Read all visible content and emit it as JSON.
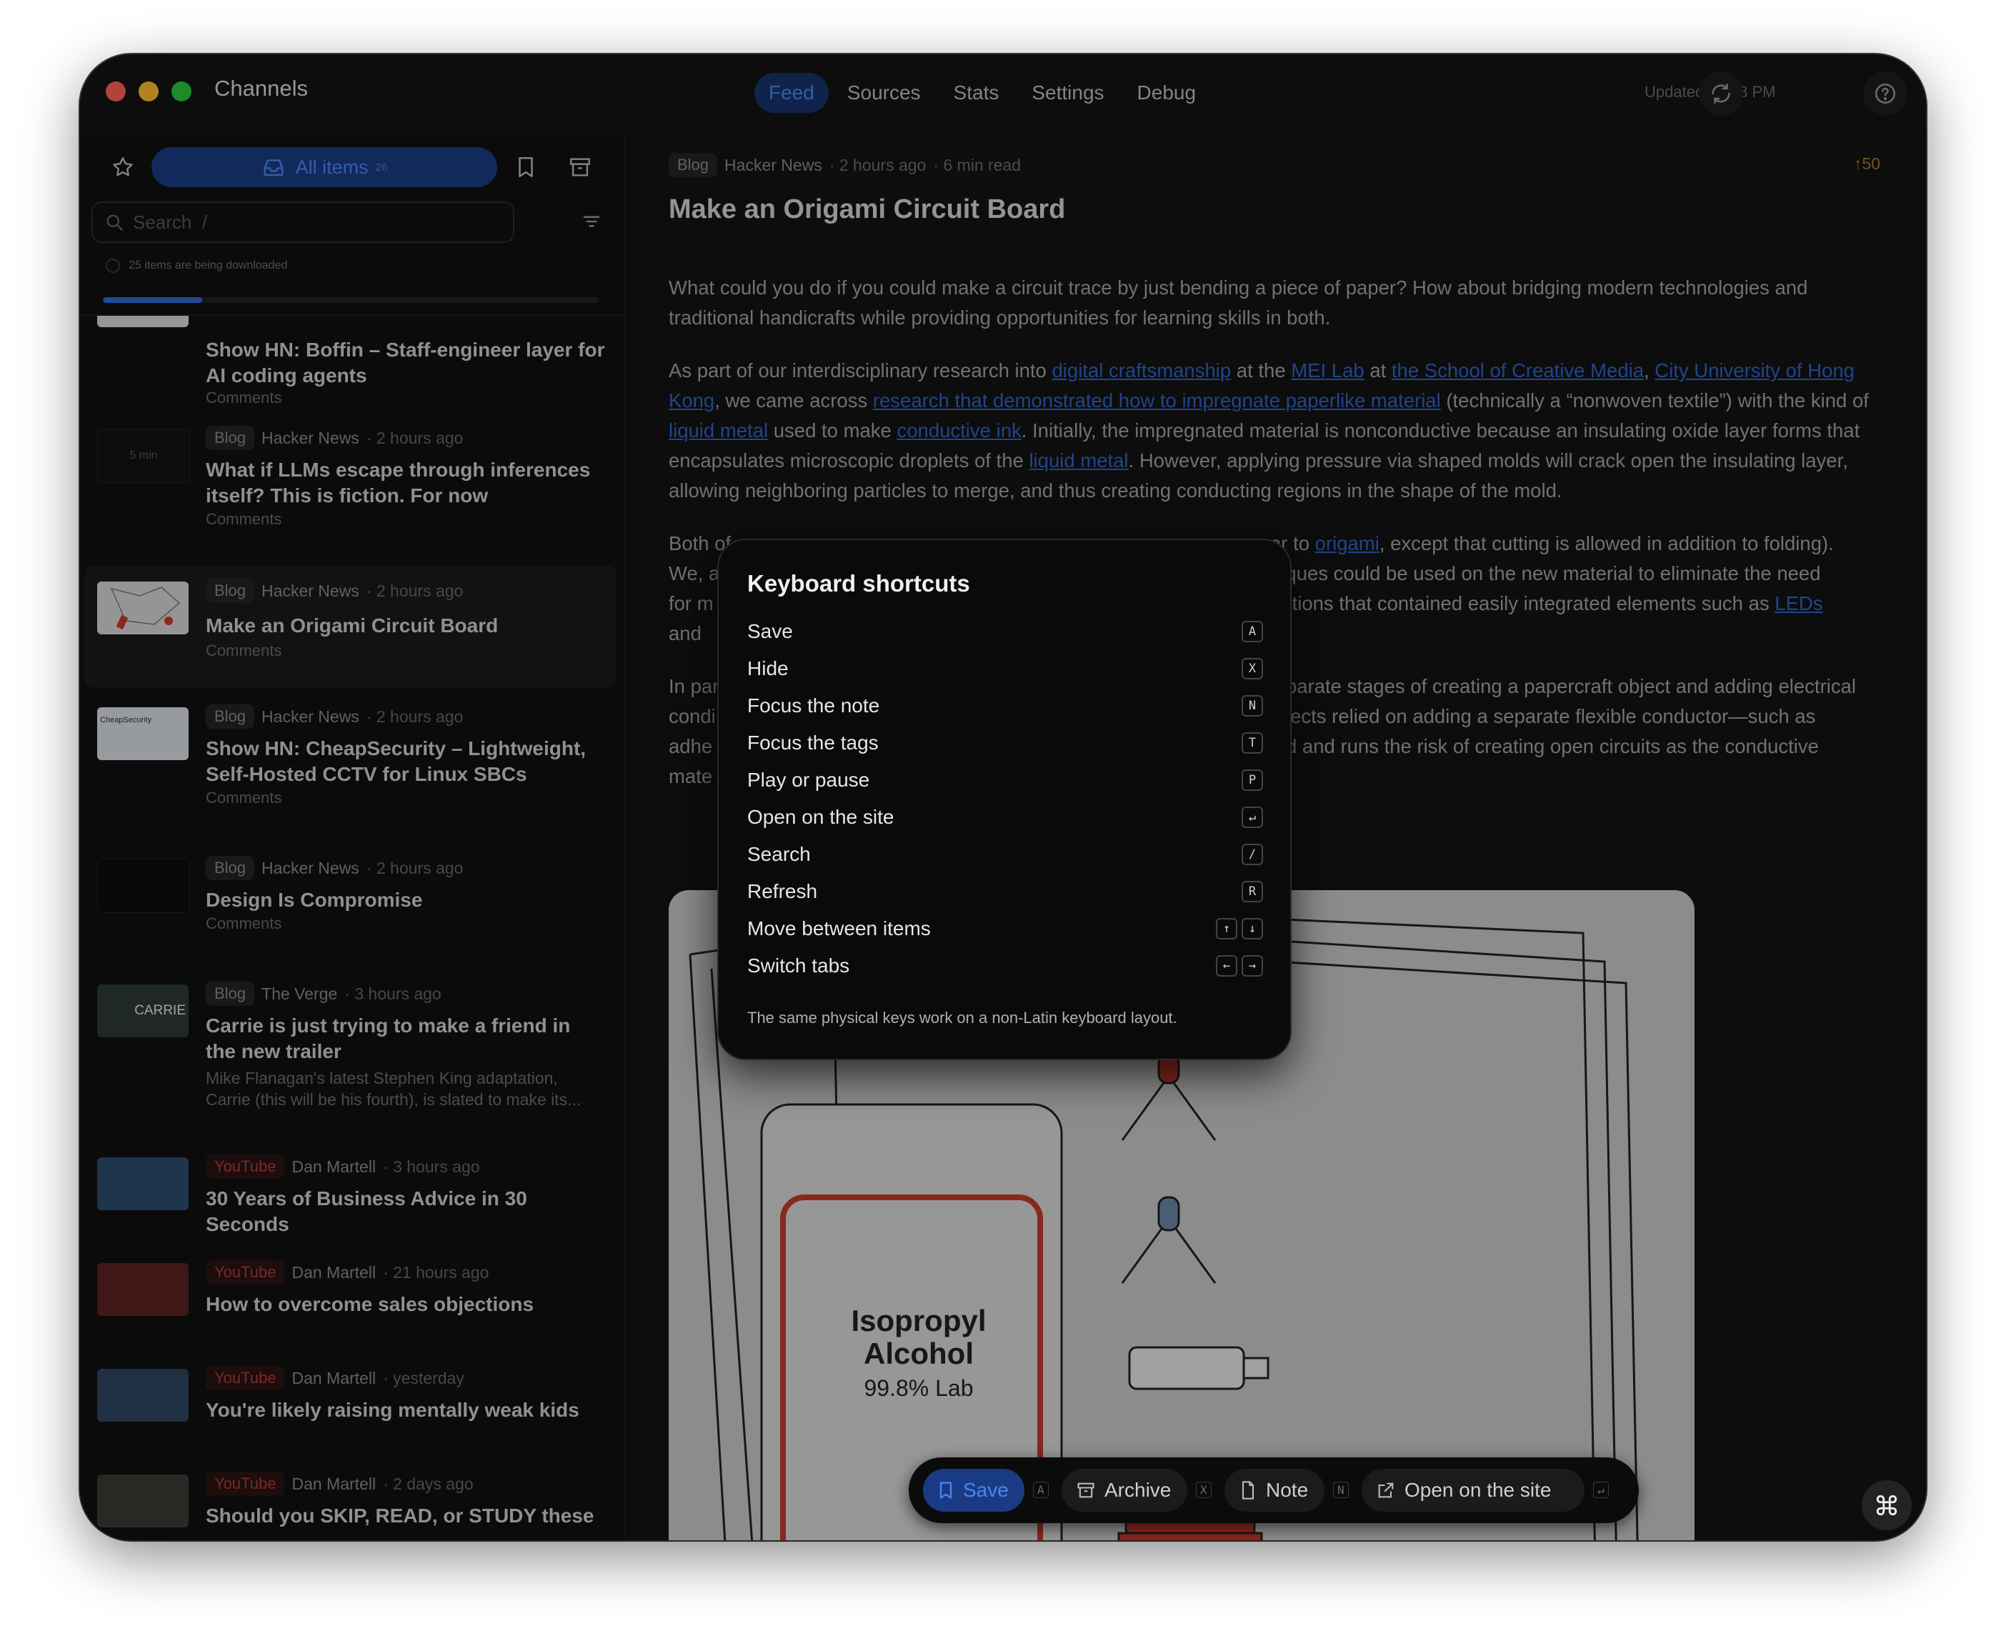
{
  "window": {
    "title": "Channels",
    "nav_tabs": [
      "Feed",
      "Sources",
      "Stats",
      "Settings",
      "Debug"
    ],
    "active_tab": "Feed",
    "updated_text": "Updated 09:13 PM",
    "accent": "#4a86f0"
  },
  "sidebar": {
    "filter_label": "All items",
    "filter_count": "26",
    "search_placeholder": "Search  /",
    "download_status": "25 items are being downloaded",
    "download_progress": 0.2,
    "items": [
      {
        "title": "Show HN: Boffin – Staff-engineer layer for AI coding agents",
        "comments": "Comments"
      },
      {
        "badge": "Blog",
        "source": "Hacker News",
        "time": "· 2 hours ago",
        "thumb_text": "5 min",
        "title": "What if LLMs escape through inferences itself? This is fiction. For now",
        "comments": "Comments"
      },
      {
        "badge": "Blog",
        "source": "Hacker News",
        "time": "· 2 hours ago",
        "title": "Make an Origami Circuit Board",
        "comments": "Comments"
      },
      {
        "badge": "Blog",
        "source": "Hacker News",
        "time": "· 2 hours ago",
        "thumb_text": "CheapSecurity",
        "title": "Show HN: CheapSecurity – Lightweight, Self-Hosted CCTV for Linux SBCs",
        "comments": "Comments"
      },
      {
        "badge": "Blog",
        "source": "Hacker News",
        "time": "· 2 hours ago",
        "title": "Design Is Compromise",
        "comments": "Comments"
      },
      {
        "badge": "Blog",
        "source": "The Verge",
        "time": "· 3 hours ago",
        "thumb_text": "CARRIE",
        "title": "Carrie is just trying to make a friend in the new trailer",
        "description": "Mike Flanagan's latest Stephen King adaptation, Carrie (this will be his fourth), is slated to make its..."
      },
      {
        "badge": "YouTube",
        "source": "Dan Martell",
        "time": "· 3 hours ago",
        "title": "30 Years of Business Advice in 30 Seconds"
      },
      {
        "badge": "YouTube",
        "source": "Dan Martell",
        "time": "· 21 hours ago",
        "title": "How to overcome sales objections"
      },
      {
        "badge": "YouTube",
        "source": "Dan Martell",
        "time": "· yesterday",
        "title": "You're likely raising mentally weak kids"
      },
      {
        "badge": "YouTube",
        "source": "Dan Martell",
        "time": "· 2 days ago",
        "title": "Should you SKIP, READ, or STUDY these"
      }
    ]
  },
  "article": {
    "badge": "Blog",
    "source": "Hacker News",
    "time": "· 2 hours ago",
    "read_time": "· 6 min read",
    "score": "↑50",
    "title": "Make an Origami Circuit Board",
    "p1": "What could you do if you could make a circuit trace by just bending a piece of paper? How about bridging modern technologies and traditional handicrafts while providing opportunities for learning skills in both.",
    "p2": {
      "t1": "As part of our interdisciplinary research into ",
      "l1": "digital craftsmanship",
      "t2": " at the ",
      "l2": "MEI Lab",
      "t3": " at ",
      "l3": "the School of Creative Media",
      "t4": ", ",
      "l4": "City University of Hong Kong",
      "t5": ", we came across ",
      "l5": "research that demonstrated how to impregnate paperlike material",
      "t6": " (technically a “nonwoven textile”) with the kind of ",
      "l6": "liquid metal",
      "t7": " used to make ",
      "l7": "conductive ink",
      "t8": ". Initially, the impregnated material is nonconductive because an insulating oxide layer forms that encapsulates microscopic droplets of the ",
      "l8": "liquid metal",
      "t9": ". However, applying pressure via shaped molds will crack open the insulating layer, allowing neighboring particles to merge, and thus creating conducting regions in the shape of the mold."
    },
    "p3": {
      "t1": "Both of",
      "t2": "ar to ",
      "l1": "origami",
      "t3": ", except that cutting is allowed in addition to folding).",
      "t4": "We, a",
      "t5": "niques could be used on the new material to eliminate the need",
      "t6": "for m",
      "t7": "eations that contained easily integrated elements such as ",
      "l2": "LEDs",
      "t8": "and "
    },
    "p4": {
      "t1": "In par",
      "t2": "parate stages of creating a papercraft object and adding electrical",
      "t3": "condi",
      "t4": "jects relied on adding a separate flexible conductor—such as",
      "t5": "adhe",
      "t6": "d and runs the risk of creating open circuits as the conductive",
      "t7": "mate"
    },
    "figure": {
      "bottle_label_1": "Isopropyl",
      "bottle_label_2": "Alcohol",
      "bottle_label_3": "99.8% Lab"
    }
  },
  "shortcuts_modal": {
    "title": "Keyboard shortcuts",
    "rows": [
      {
        "label": "Save",
        "keys": [
          "A"
        ]
      },
      {
        "label": "Hide",
        "keys": [
          "X"
        ]
      },
      {
        "label": "Focus the note",
        "keys": [
          "N"
        ]
      },
      {
        "label": "Focus the tags",
        "keys": [
          "T"
        ]
      },
      {
        "label": "Play or pause",
        "keys": [
          "P"
        ]
      },
      {
        "label": "Open on the site",
        "keys": [
          "↵"
        ]
      },
      {
        "label": "Search",
        "keys": [
          "/"
        ]
      },
      {
        "label": "Refresh",
        "keys": [
          "R"
        ]
      },
      {
        "label": "Move between items",
        "keys": [
          "↑",
          "↓"
        ]
      },
      {
        "label": "Switch tabs",
        "keys": [
          "←",
          "→"
        ]
      }
    ],
    "footer": "The same physical keys work on a non-Latin keyboard layout."
  },
  "action_bar": {
    "save": {
      "label": "Save",
      "key": "A"
    },
    "archive": {
      "label": "Archive",
      "key": "X"
    },
    "note": {
      "label": "Note",
      "key": "N"
    },
    "open": {
      "label": "Open on the site",
      "key": "↵"
    }
  },
  "icons": {
    "star": "star-icon",
    "inbox": "inbox-icon",
    "bookmark": "bookmark-icon",
    "archive": "archive-icon",
    "search": "search-icon",
    "filter": "filter-icon",
    "refresh": "refresh-icon",
    "help": "help-icon",
    "note": "note-icon",
    "external": "external-link-icon",
    "command": "command-icon"
  },
  "colors": {
    "youtube_badge": "#b03a3a",
    "link": "#2f63c4",
    "score": "#a5782a"
  }
}
